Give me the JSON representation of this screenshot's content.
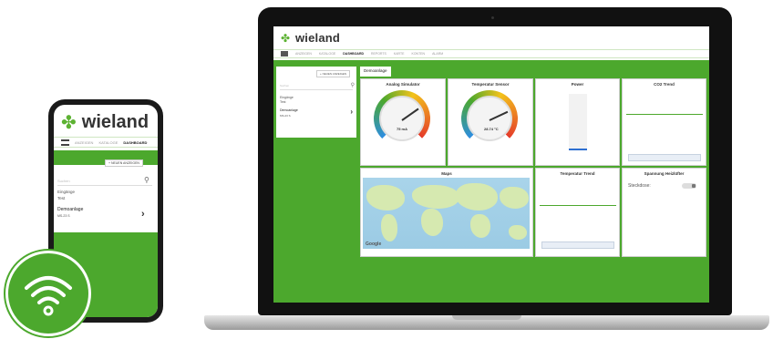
{
  "app": {
    "brand": "wieland",
    "nav": [
      "ANZEIGEN",
      "KATALOGE",
      "DASHBOARD",
      "REPORTS",
      "KARTE",
      "KONTEN",
      "ALARM"
    ],
    "nav_active": "DASHBOARD",
    "sidebar": {
      "button": "+ NEUEN ANZEIGEN",
      "search_placeholder": "Suchen",
      "row1": "Eingänge",
      "row2": "Test",
      "item_title": "Demoanlage",
      "item_sub": "MS-23 S"
    },
    "tab": "Demoanlage",
    "panels": {
      "analog": "Analog Simulator",
      "temp_sensor": "Temperatur Sensor",
      "power": "Power",
      "co2": "CO2 Trend",
      "maps": "Maps",
      "temp_trend": "Temperatur Trend",
      "spannung": "Spannung Heizlüfter"
    },
    "gauge1_value": "75 mA",
    "gauge2_value": "28.74 °C",
    "steckdose_label": "Steckdose:",
    "google": "Google"
  },
  "phone": {
    "brand": "wieland",
    "nav": [
      "ANZEIGEN",
      "KATALOGE",
      "DASHBOARD"
    ],
    "button": "+ NEUEN ANZEIGEN",
    "search_placeholder": "Suchen",
    "row1": "Eingänge",
    "row2": "Test",
    "item_title": "Demoanlage",
    "item_sub": "MS-23 S"
  },
  "icons": {
    "logo": "wieland-clover-icon",
    "wifi": "wifi-icon"
  },
  "colors": {
    "brand_green": "#4ca82d",
    "text_dark": "#333333"
  }
}
